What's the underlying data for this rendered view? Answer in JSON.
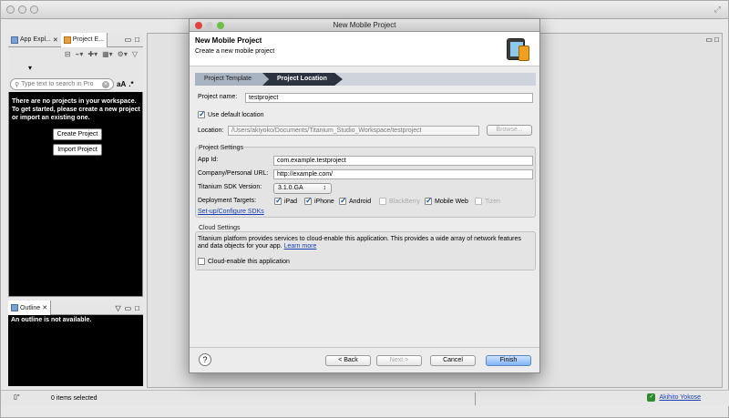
{
  "main_window": {
    "panel_tabs": [
      "App Expl...",
      "Project E..."
    ],
    "search_placeholder": "Type text to search in Pro",
    "search_aa": "aA",
    "search_star": ".*",
    "empty_message": "There are no projects in your workspace. To get started, please create a new project or import an existing one.",
    "create_project": "Create Project",
    "import_project": "Import Project",
    "outline_tab": "Outline",
    "outline_message": "An outline is not available.",
    "status_text": "0 items selected",
    "user_name": "Akihito Yokose"
  },
  "dialog": {
    "window_title": "New Mobile Project",
    "header_title": "New Mobile Project",
    "header_subtitle": "Create a new mobile project",
    "steps": [
      "Project Template",
      "Project Location"
    ],
    "project_name_label": "Project name:",
    "project_name_value": "testproject",
    "use_default_location": "Use default location",
    "location_label": "Location:",
    "location_value": "/Users/akiyoko/Documents/Titanium_Studio_Workspace/testproject",
    "browse": "Browse...",
    "project_settings_title": "Project Settings",
    "app_id_label": "App Id:",
    "app_id_value": "com.example.testproject",
    "company_url_label": "Company/Personal URL:",
    "company_url_value": "http://example.com/",
    "sdk_label": "Titanium SDK Version:",
    "sdk_value": "3.1.0.GA",
    "deployment_label": "Deployment Targets:",
    "targets": [
      {
        "name": "iPad",
        "checked": true
      },
      {
        "name": "iPhone",
        "checked": true
      },
      {
        "name": "Android",
        "checked": true
      },
      {
        "name": "BlackBerry",
        "checked": false
      },
      {
        "name": "Mobile Web",
        "checked": true
      },
      {
        "name": "Tizen",
        "checked": false
      }
    ],
    "sdk_config_link": "Set-up/Configure SDKs",
    "cloud_settings_title": "Cloud Settings",
    "cloud_description": "Titanium platform provides services to cloud-enable this application. This provides a wide array of network features and data objects for your app.",
    "learn_more": "Learn more",
    "cloud_enable": "Cloud-enable this application",
    "back": "< Back",
    "next": "Next >",
    "cancel": "Cancel",
    "finish": "Finish"
  }
}
